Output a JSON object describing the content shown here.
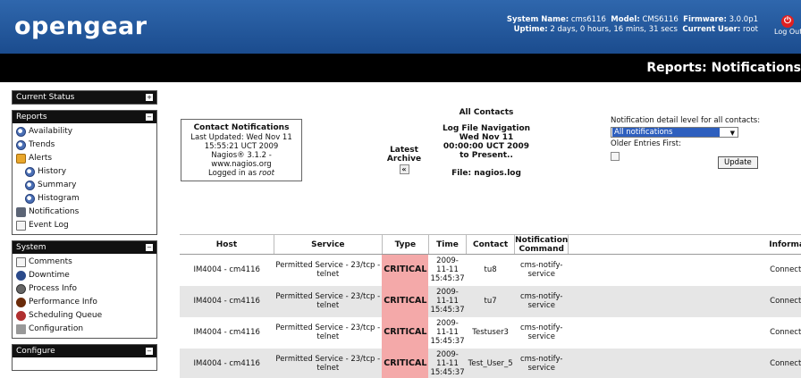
{
  "header": {
    "logo": "opengear",
    "system_name_label": "System Name:",
    "system_name": "cms6116",
    "model_label": "Model:",
    "model": "CMS6116",
    "firmware_label": "Firmware:",
    "firmware": "3.0.0p1",
    "uptime_label": "Uptime:",
    "uptime": "2 days, 0 hours, 16 mins, 31 secs",
    "current_user_label": "Current User:",
    "current_user": "root",
    "logout_label": "Log Out",
    "page_title": "Reports: Notifications"
  },
  "sidebar": {
    "current_status": "Current Status",
    "reports": {
      "title": "Reports",
      "items": [
        "Availability",
        "Trends",
        "Alerts",
        "History",
        "Summary",
        "Histogram",
        "Notifications",
        "Event Log"
      ]
    },
    "system": {
      "title": "System",
      "items": [
        "Comments",
        "Downtime",
        "Process Info",
        "Performance Info",
        "Scheduling Queue",
        "Configuration"
      ]
    },
    "configure": {
      "title": "Configure"
    }
  },
  "contact_box": {
    "title": "Contact Notifications",
    "updated": "Last Updated: Wed Nov 11 15:55:21 UCT 2009",
    "version": "Nagios® 3.1.2 - www.nagios.org",
    "logged_in_prefix": "Logged in as ",
    "logged_in_user": "root"
  },
  "archive": {
    "label": "Latest Archive",
    "arrow": "«"
  },
  "log_nav": {
    "heading": "All Contacts",
    "nav": "Log File Navigation Wed Nov 11 00:00:00 UCT 2009 to Present..",
    "file": "File: nagios.log"
  },
  "options": {
    "detail_label": "Notification detail level for all contacts:",
    "detail_value": "All notifications",
    "older_label": "Older Entries First:",
    "update_label": "Update"
  },
  "table": {
    "headers": [
      "Host",
      "Service",
      "Type",
      "Time",
      "Contact",
      "Notification Command",
      "Information"
    ],
    "rows": [
      {
        "host": "IM4004 - cm4116",
        "service": "Permitted Service - 23/tcp - telnet",
        "type": "CRITICAL",
        "time": "2009-11-11 15:45:37",
        "contact": "tu8",
        "command": "cms-notify-service",
        "info": "Connection re"
      },
      {
        "host": "IM4004 - cm4116",
        "service": "Permitted Service - 23/tcp - telnet",
        "type": "CRITICAL",
        "time": "2009-11-11 15:45:37",
        "contact": "tu7",
        "command": "cms-notify-service",
        "info": "Connection re"
      },
      {
        "host": "IM4004 - cm4116",
        "service": "Permitted Service - 23/tcp - telnet",
        "type": "CRITICAL",
        "time": "2009-11-11 15:45:37",
        "contact": "Testuser3",
        "command": "cms-notify-service",
        "info": "Connection re"
      },
      {
        "host": "IM4004 - cm4116",
        "service": "Permitted Service - 23/tcp - telnet",
        "type": "CRITICAL",
        "time": "2009-11-11 15:45:37",
        "contact": "Test_User_5",
        "command": "cms-notify-service",
        "info": "Connection re"
      }
    ]
  },
  "colors": {
    "header_blue": "#2f67ad",
    "critical": "#f4a9a9",
    "select_blue": "#2e5fbe"
  }
}
